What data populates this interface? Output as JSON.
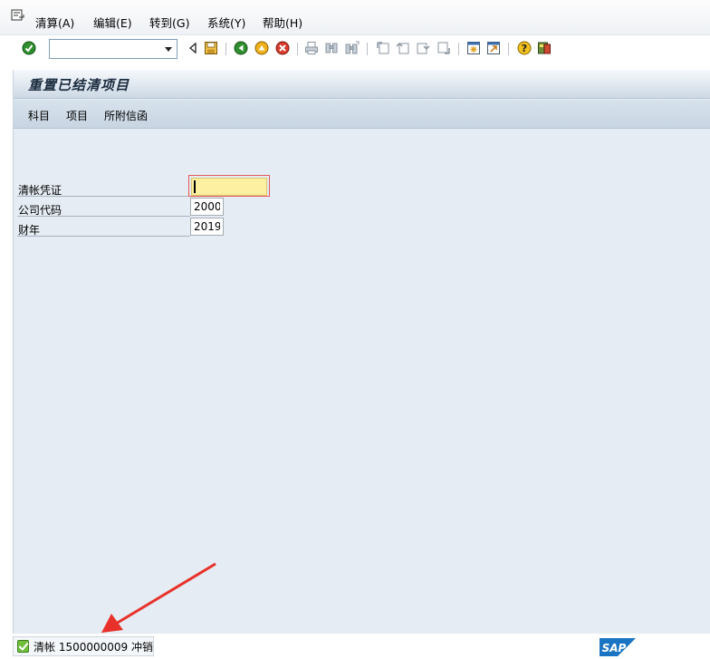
{
  "menubar": {
    "items": [
      {
        "label": "清算(A)"
      },
      {
        "label": "编辑(E)"
      },
      {
        "label": "转到(G)"
      },
      {
        "label": "系统(Y)"
      },
      {
        "label": "帮助(H)"
      }
    ]
  },
  "toolbar": {
    "command_field_value": "",
    "icons": [
      "enter-icon",
      "back-triangle-icon",
      "save-icon",
      "back-icon",
      "exit-icon",
      "cancel-icon",
      "print-icon",
      "find-icon",
      "find-next-icon",
      "first-page-icon",
      "previous-page-icon",
      "next-page-icon",
      "last-page-icon",
      "create-session-icon",
      "shortcut-icon",
      "help-icon",
      "layout-menu-icon"
    ]
  },
  "screen": {
    "title": "重置已结清项目",
    "app_buttons": [
      {
        "label": "科目"
      },
      {
        "label": "项目"
      },
      {
        "label": "所附信函"
      }
    ],
    "fields": [
      {
        "label": "清帐凭证",
        "value": ""
      },
      {
        "label": "公司代码",
        "value": "2000"
      },
      {
        "label": "财年",
        "value": "2019"
      }
    ]
  },
  "statusbar": {
    "message": "清帐 1500000009 冲销",
    "logo_text": "SAP"
  },
  "colors": {
    "accent_arrow": "#e8312a",
    "work_area_bg": "#e5ecf3",
    "focus_field_bg": "#fdf0a0",
    "sap_logo": "#1a74c4"
  }
}
